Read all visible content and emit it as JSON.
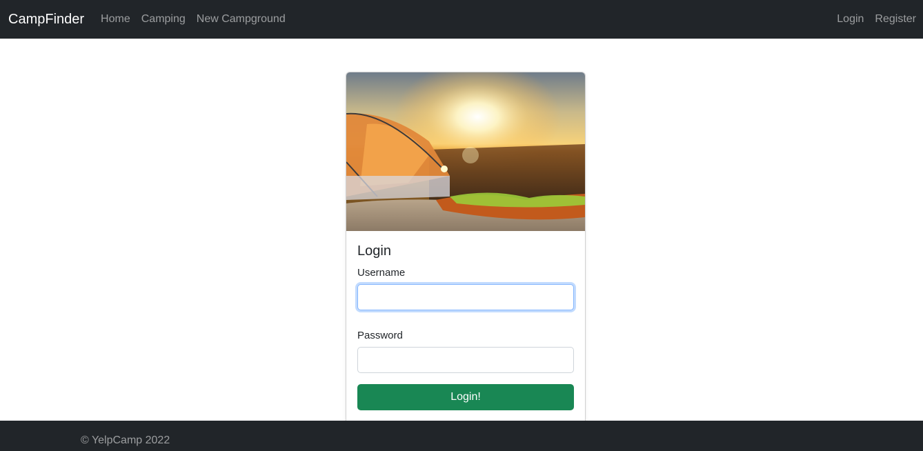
{
  "navbar": {
    "brand": "CampFinder",
    "links": [
      "Home",
      "Camping",
      "New Campground"
    ],
    "auth": [
      "Login",
      "Register"
    ]
  },
  "card": {
    "title": "Login",
    "username_label": "Username",
    "username_value": "",
    "password_label": "Password",
    "password_value": "",
    "submit_label": "Login!"
  },
  "footer": {
    "text": "© YelpCamp 2022"
  },
  "colors": {
    "navbar_bg": "#212529",
    "button_bg": "#198754",
    "focus_border": "#86b7fe"
  }
}
